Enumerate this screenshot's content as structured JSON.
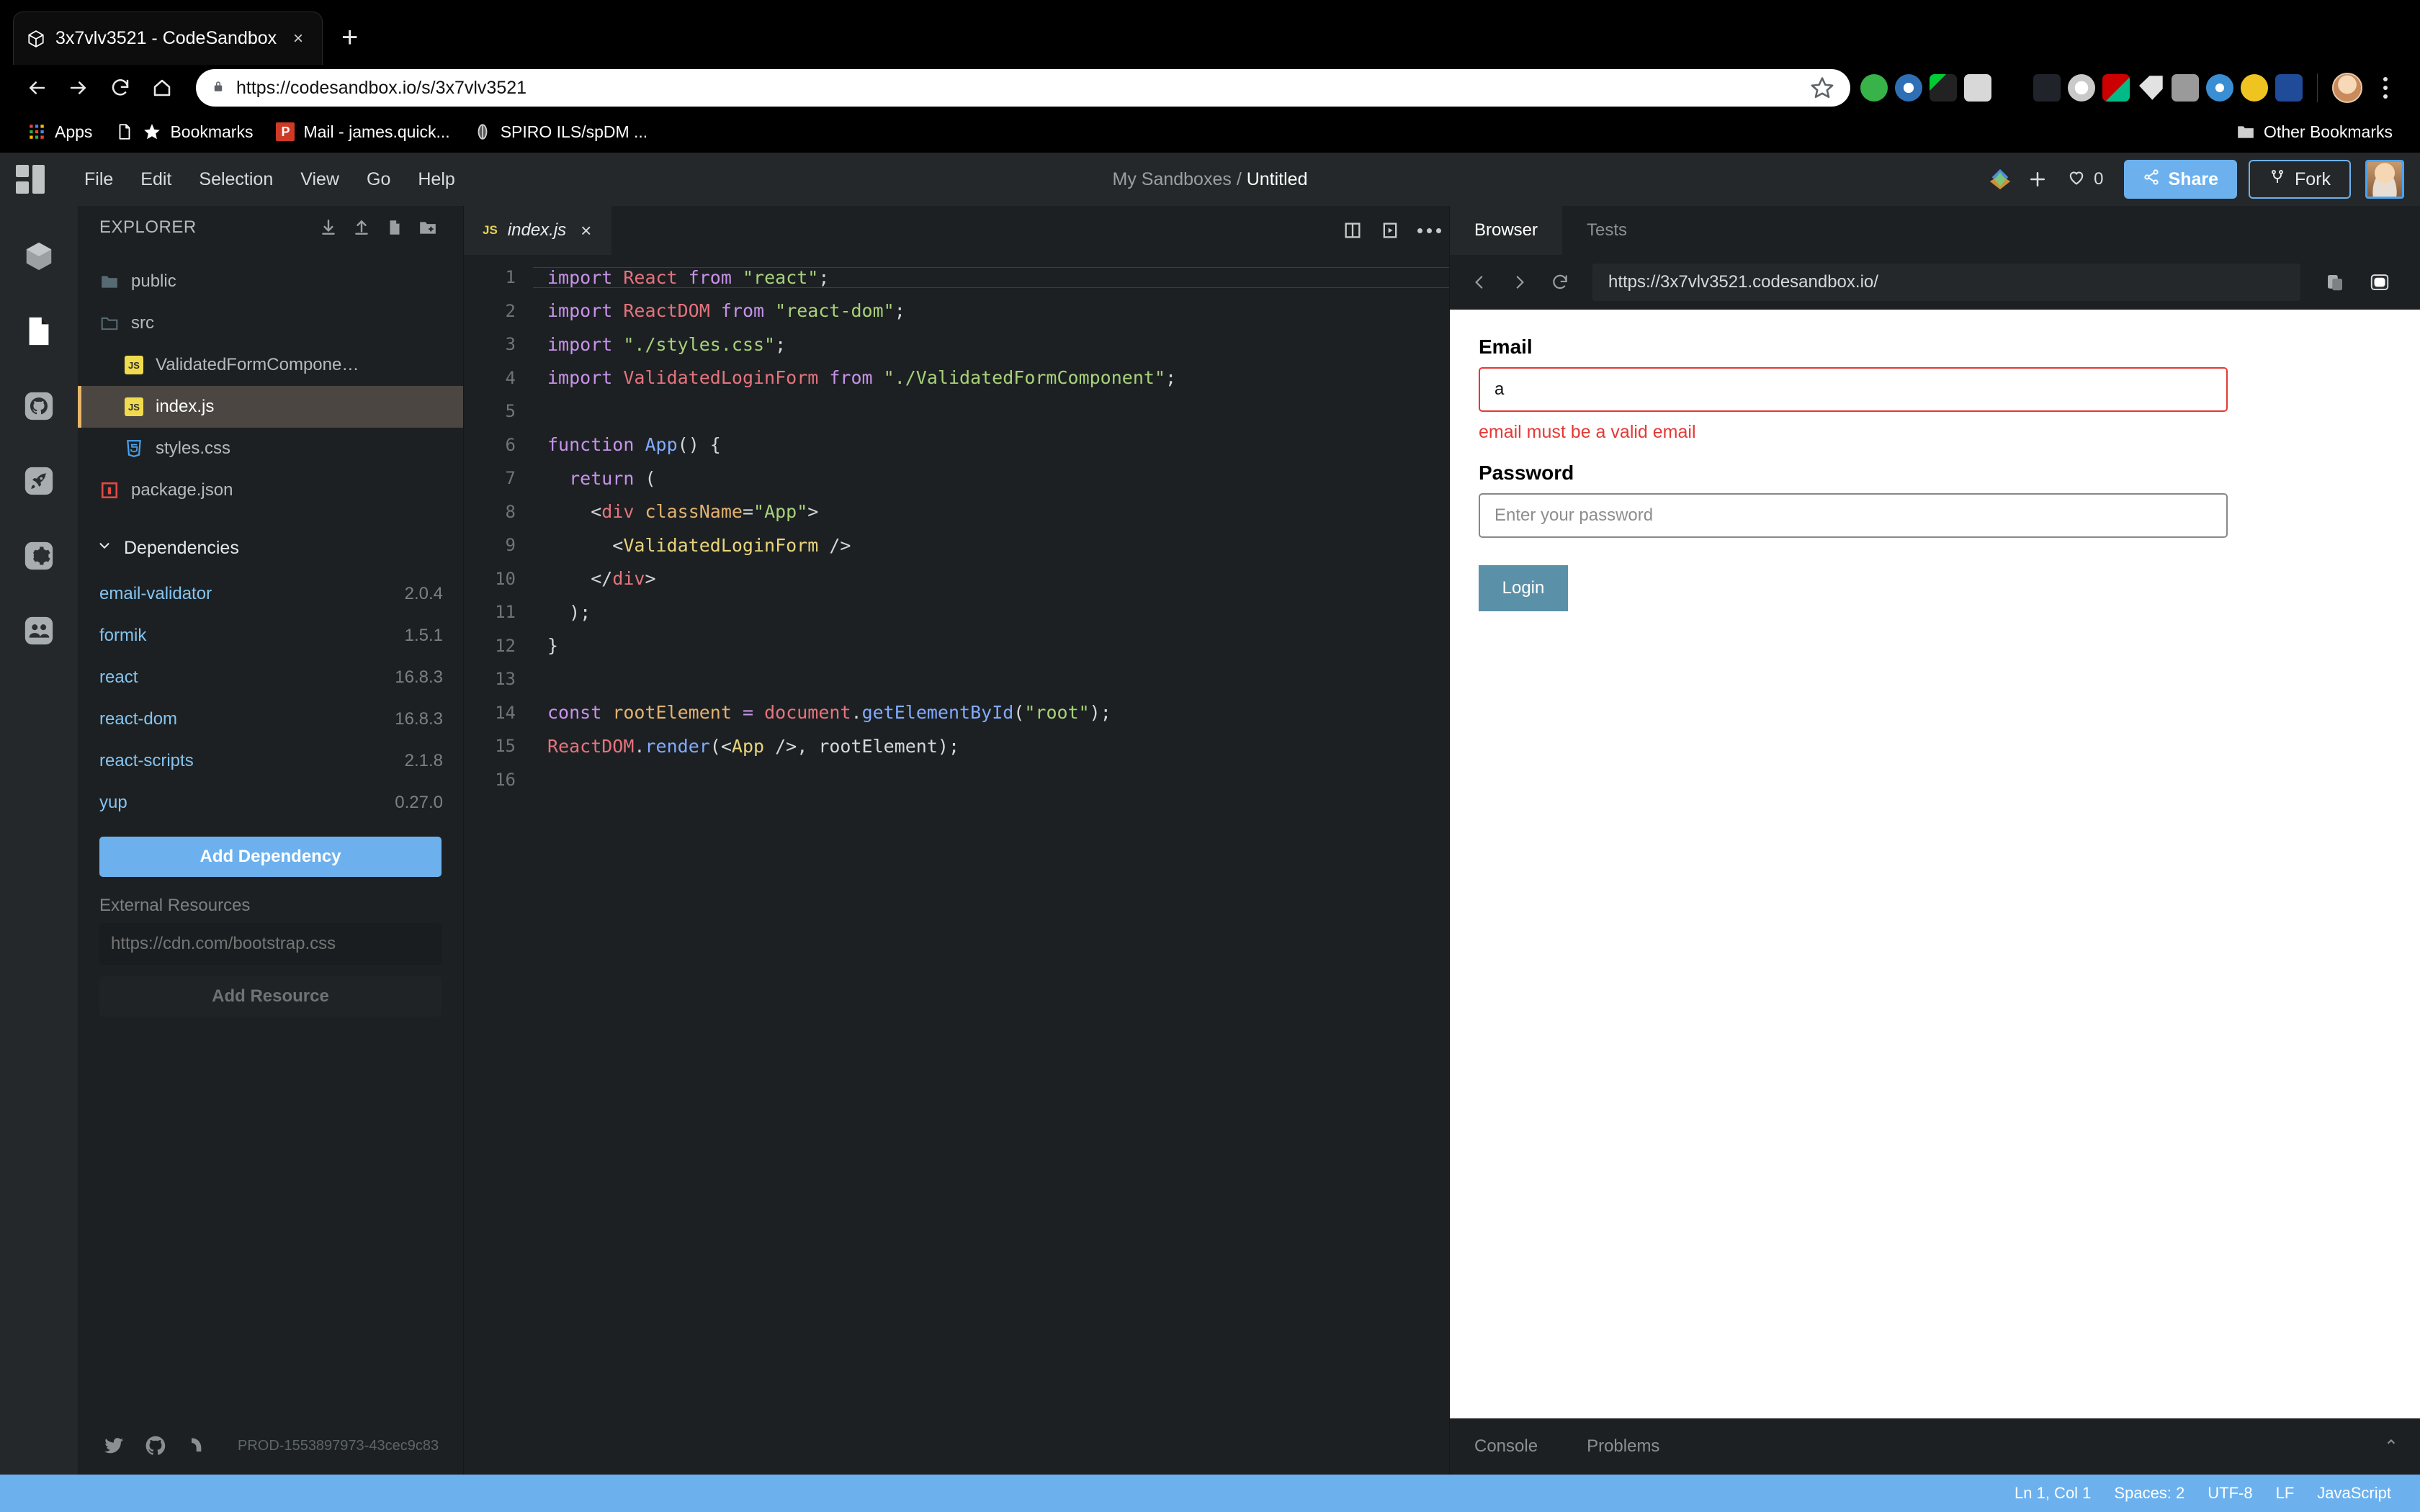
{
  "browser": {
    "tab": {
      "title": "3x7vlv3521 - CodeSandbox",
      "favicon": "codesandbox-logo-icon",
      "close": "×"
    },
    "new_tab_label": "+",
    "nav": {
      "back": "back-icon",
      "forward": "forward-icon",
      "reload": "reload-icon",
      "home": "home-icon"
    },
    "omnibox": {
      "url": "https://codesandbox.io/s/3x7vlv3521",
      "url_host": "codesandbox.io",
      "lock": "lock-icon",
      "star": "star-icon"
    },
    "extensions": [
      "thumbs-up-extension",
      "blue-ring-extension",
      "pen-extension",
      "honey-extension",
      "diamond-extension",
      "react-devtools-extension",
      "white-ring-extension",
      "flash-extension",
      "tag-extension",
      "ib-extension",
      "g-extension",
      "moon-extension",
      "s-extension"
    ],
    "profile": "user-avatar",
    "menu": "chrome-menu-icon",
    "bookmarks": [
      {
        "label": "Apps",
        "icon": "apps-grid-icon"
      },
      {
        "label": "Bookmarks",
        "icon": "star-icon"
      },
      {
        "label": "Mail - james.quick...",
        "icon": "powerpoint-icon"
      },
      {
        "label": "SPIRO ILS/spDM ...",
        "icon": "globe-icon"
      }
    ],
    "other_bookmarks": {
      "label": "Other Bookmarks",
      "icon": "folder-icon"
    }
  },
  "codesandbox": {
    "header": {
      "logo": "codesandbox-grid-logo",
      "menus": [
        "File",
        "Edit",
        "Selection",
        "View",
        "Go",
        "Help"
      ],
      "title_prefix": "My Sandboxes /",
      "title_name": "Untitled",
      "preferences_icon": "color-palette-icon",
      "plus_icon": "+",
      "like_icon": "heart-icon",
      "like_count": "0",
      "share_label": "Share",
      "share_icon": "share-icon",
      "share_color": "#6cb1ee",
      "fork_label": "Fork",
      "fork_icon": "fork-icon",
      "avatar": "user-avatar"
    },
    "activitybar": [
      {
        "name": "sandbox-explorer",
        "icon": "cube-icon",
        "active": false
      },
      {
        "name": "files",
        "icon": "file-icon",
        "active": true
      },
      {
        "name": "github",
        "icon": "github-icon",
        "active": false
      },
      {
        "name": "deployment",
        "icon": "rocket-icon",
        "active": false
      },
      {
        "name": "settings",
        "icon": "gear-icon",
        "active": false
      },
      {
        "name": "live",
        "icon": "people-icon",
        "active": false
      }
    ],
    "explorer": {
      "title": "EXPLORER",
      "actions": [
        "download-icon",
        "upload-icon",
        "new-file-icon",
        "new-folder-icon"
      ],
      "files": [
        {
          "label": "public",
          "type": "folder",
          "icon": "folder-filled-icon",
          "indent": 0,
          "active": false
        },
        {
          "label": "src",
          "type": "folder",
          "icon": "folder-open-icon",
          "indent": 0,
          "active": false
        },
        {
          "label": "ValidatedFormCompone…",
          "type": "file",
          "icon": "js-icon",
          "indent": 1,
          "active": false
        },
        {
          "label": "index.js",
          "type": "file",
          "icon": "js-icon",
          "indent": 1,
          "active": true
        },
        {
          "label": "styles.css",
          "type": "file",
          "icon": "css-icon",
          "indent": 1,
          "active": false
        },
        {
          "label": "package.json",
          "type": "file",
          "icon": "json-icon",
          "indent": 0,
          "active": false
        }
      ]
    },
    "dependencies": {
      "title": "Dependencies",
      "chevron": "chevron-down-icon",
      "items": [
        {
          "name": "email-validator",
          "version": "2.0.4"
        },
        {
          "name": "formik",
          "version": "1.5.1"
        },
        {
          "name": "react",
          "version": "16.8.3"
        },
        {
          "name": "react-dom",
          "version": "16.8.3"
        },
        {
          "name": "react-scripts",
          "version": "2.1.8"
        },
        {
          "name": "yup",
          "version": "0.27.0"
        }
      ],
      "add_button": "Add Dependency"
    },
    "external_resources": {
      "title": "External Resources",
      "placeholder": "https://cdn.com/bootstrap.css",
      "value": "",
      "add_button": "Add Resource"
    },
    "sidebar_footer": {
      "icons": [
        "twitter-icon",
        "github-icon",
        "discord-icon"
      ],
      "build": "PROD-1553897973-43cec9c83"
    },
    "editor": {
      "tab": {
        "label": "index.js",
        "badge": "JS",
        "close": "×"
      },
      "actions": [
        "split-pane-icon",
        "open-preview-icon",
        "more-options-icon"
      ],
      "status": {
        "line_col": "Ln 1, Col 1",
        "spaces": "Spaces: 2",
        "encoding": "UTF-8",
        "eol": "LF",
        "language": "JavaScript"
      },
      "lines": [
        {
          "n": "1",
          "tokens": [
            [
              "k",
              "import"
            ],
            [
              "pn",
              " "
            ],
            [
              "cl",
              "React"
            ],
            [
              "pn",
              " "
            ],
            [
              "k",
              "from"
            ],
            [
              "pn",
              " "
            ],
            [
              "st",
              "\"react\""
            ],
            [
              "pn",
              ";"
            ]
          ]
        },
        {
          "n": "2",
          "tokens": [
            [
              "k",
              "import"
            ],
            [
              "pn",
              " "
            ],
            [
              "cl",
              "ReactDOM"
            ],
            [
              "pn",
              " "
            ],
            [
              "k",
              "from"
            ],
            [
              "pn",
              " "
            ],
            [
              "st",
              "\"react-dom\""
            ],
            [
              "pn",
              ";"
            ]
          ]
        },
        {
          "n": "3",
          "tokens": [
            [
              "k",
              "import"
            ],
            [
              "pn",
              " "
            ],
            [
              "st",
              "\"./styles.css\""
            ],
            [
              "pn",
              ";"
            ]
          ]
        },
        {
          "n": "4",
          "tokens": [
            [
              "k",
              "import"
            ],
            [
              "pn",
              " "
            ],
            [
              "cl",
              "ValidatedLoginForm"
            ],
            [
              "pn",
              " "
            ],
            [
              "k",
              "from"
            ],
            [
              "pn",
              " "
            ],
            [
              "st",
              "\"./ValidatedFormComponent\""
            ],
            [
              "pn",
              ";"
            ]
          ]
        },
        {
          "n": "5",
          "tokens": []
        },
        {
          "n": "6",
          "tokens": [
            [
              "k",
              "function"
            ],
            [
              "pn",
              " "
            ],
            [
              "fn",
              "App"
            ],
            [
              "pn",
              "() {"
            ]
          ]
        },
        {
          "n": "7",
          "tokens": [
            [
              "pn",
              "  "
            ],
            [
              "k",
              "return"
            ],
            [
              "pn",
              " ("
            ]
          ]
        },
        {
          "n": "8",
          "tokens": [
            [
              "pn",
              "    <"
            ],
            [
              "tg",
              "div"
            ],
            [
              "pn",
              " "
            ],
            [
              "at",
              "className"
            ],
            [
              "pn",
              "="
            ],
            [
              "st",
              "\"App\""
            ],
            [
              "pn",
              ">"
            ]
          ]
        },
        {
          "n": "9",
          "tokens": [
            [
              "pn",
              "      <"
            ],
            [
              "cp",
              "ValidatedLoginForm"
            ],
            [
              "pn",
              " />"
            ]
          ]
        },
        {
          "n": "10",
          "tokens": [
            [
              "pn",
              "    </"
            ],
            [
              "tg",
              "div"
            ],
            [
              "pn",
              ">"
            ]
          ]
        },
        {
          "n": "11",
          "tokens": [
            [
              "pn",
              "  );"
            ]
          ]
        },
        {
          "n": "12",
          "tokens": [
            [
              "pn",
              "}"
            ]
          ]
        },
        {
          "n": "13",
          "tokens": []
        },
        {
          "n": "14",
          "tokens": [
            [
              "k",
              "const"
            ],
            [
              "pn",
              " "
            ],
            [
              "vr",
              "rootElement"
            ],
            [
              "pn",
              " "
            ],
            [
              "k",
              "="
            ],
            [
              "pn",
              " "
            ],
            [
              "cl",
              "document"
            ],
            [
              "pn",
              "."
            ],
            [
              "fn",
              "getElementById"
            ],
            [
              "pn",
              "("
            ],
            [
              "st",
              "\"root\""
            ],
            [
              "pn",
              ");"
            ]
          ]
        },
        {
          "n": "15",
          "tokens": [
            [
              "cl",
              "ReactDOM"
            ],
            [
              "pn",
              "."
            ],
            [
              "fn",
              "render"
            ],
            [
              "pn",
              "(<"
            ],
            [
              "cp",
              "App"
            ],
            [
              "pn",
              " />, "
            ],
            [
              "pn",
              "rootElement);"
            ]
          ]
        },
        {
          "n": "16",
          "tokens": []
        }
      ]
    },
    "preview": {
      "tabs": [
        {
          "label": "Browser",
          "active": true
        },
        {
          "label": "Tests",
          "active": false
        }
      ],
      "nav": {
        "back": "chevron-left-icon",
        "forward": "chevron-right-icon",
        "reload": "reload-icon"
      },
      "url": "https://3x7vlv3521.codesandbox.io/",
      "actions": [
        "open-in-new-window-icon",
        "responsive-mode-icon"
      ],
      "collapse_icon": "chevron-collapse-icon",
      "console_tabs": [
        "Console",
        "Problems"
      ],
      "console_caret": "⌃",
      "app": {
        "email_label": "Email",
        "email_value": "a",
        "email_placeholder": "",
        "email_error": "email must be a valid email",
        "error_color": "#e53935",
        "password_label": "Password",
        "password_value": "",
        "password_placeholder": "Enter your password",
        "login_label": "Login",
        "login_color": "#5b91a8"
      }
    }
  }
}
